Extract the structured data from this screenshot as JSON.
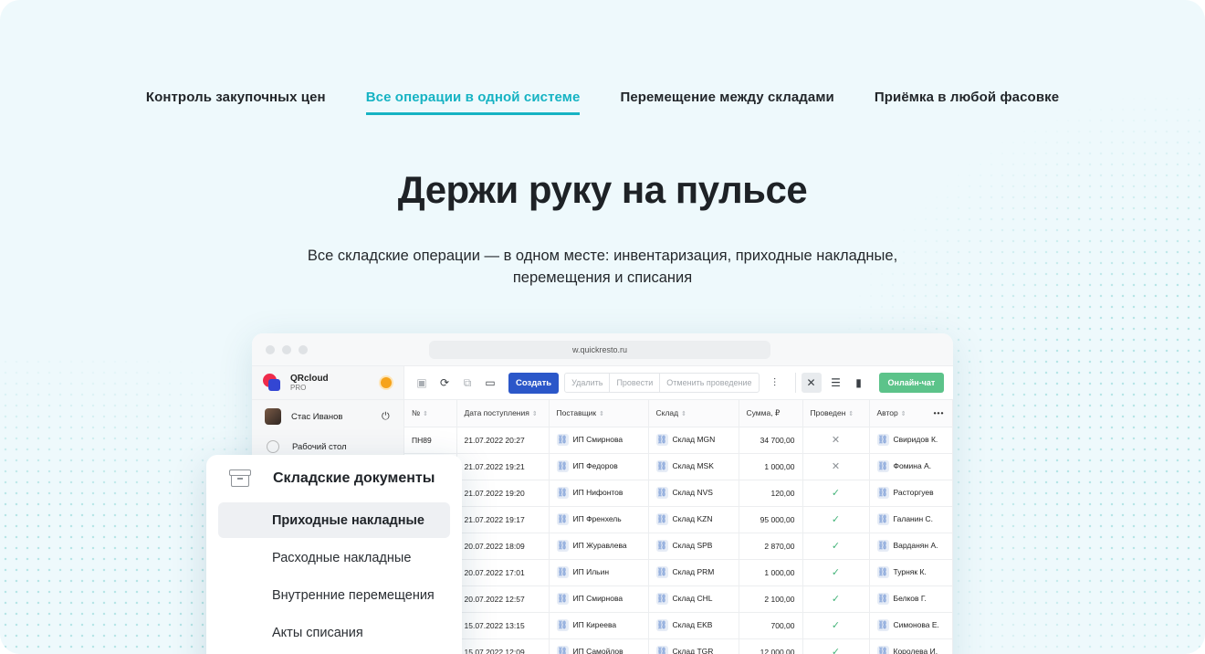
{
  "tabs": [
    {
      "label": "Контроль закупочных цен",
      "active": false
    },
    {
      "label": "Все операции в одной системе",
      "active": true
    },
    {
      "label": "Перемещение между складами",
      "active": false
    },
    {
      "label": "Приёмка в любой фасовке",
      "active": false
    }
  ],
  "headline": "Держи руку на пульсе",
  "subtitle_line1": "Все складские операции — в одном месте: инвентаризация, приходные накладные,",
  "subtitle_line2": "перемещения и списания",
  "browser": {
    "url": "w.quickresto.ru",
    "brand": {
      "name": "QRcloud",
      "plan": "PRO"
    },
    "user": "Стас Иванов",
    "side_items": [
      "Рабочий стол"
    ],
    "toolbar": {
      "create": "Создать",
      "delete": "Удалить",
      "post": "Провести",
      "unpost": "Отменить проведение",
      "chat": "Онлайн-чат"
    },
    "columns": [
      "№",
      "Дата поступления",
      "Поставщик",
      "Склад",
      "Сумма, ₽",
      "Проведен",
      "Автор"
    ],
    "rows": [
      {
        "num": "ПН89",
        "date": "21.07.2022 20:27",
        "supplier": "ИП Смирнова",
        "warehouse": "Склад MGN",
        "sum": "34 700,00",
        "posted": false,
        "author": "Свиридов К."
      },
      {
        "num": "",
        "date": "21.07.2022 19:21",
        "supplier": "ИП Федоров",
        "warehouse": "Склад MSK",
        "sum": "1 000,00",
        "posted": false,
        "author": "Фомина А."
      },
      {
        "num": "",
        "date": "21.07.2022 19:20",
        "supplier": "ИП Нифонтов",
        "warehouse": "Склад NVS",
        "sum": "120,00",
        "posted": true,
        "author": "Расторгуев"
      },
      {
        "num": "",
        "date": "21.07.2022 19:17",
        "supplier": "ИП Френхель",
        "warehouse": "Склад KZN",
        "sum": "95 000,00",
        "posted": true,
        "author": "Галанин С."
      },
      {
        "num": "",
        "date": "20.07.2022 18:09",
        "supplier": "ИП Журавлева",
        "warehouse": "Склад SPB",
        "sum": "2 870,00",
        "posted": true,
        "author": "Варданян А."
      },
      {
        "num": "",
        "date": "20.07.2022 17:01",
        "supplier": "ИП Ильин",
        "warehouse": "Склад PRM",
        "sum": "1 000,00",
        "posted": true,
        "author": "Турняк К."
      },
      {
        "num": "",
        "date": "20.07.2022 12:57",
        "supplier": "ИП Смирнова",
        "warehouse": "Склад CHL",
        "sum": "2 100,00",
        "posted": true,
        "author": "Белков Г."
      },
      {
        "num": "",
        "date": "15.07.2022 13:15",
        "supplier": "ИП Киреева",
        "warehouse": "Склад EKB",
        "sum": "700,00",
        "posted": true,
        "author": "Симонова Е."
      },
      {
        "num": "",
        "date": "15.07.2022 12:09",
        "supplier": "ИП Самойлов",
        "warehouse": "Склад TGR",
        "sum": "12 000,00",
        "posted": true,
        "author": "Королева И."
      }
    ]
  },
  "doc_menu": {
    "title": "Складские документы",
    "items": [
      {
        "label": "Приходные накладные",
        "active": true
      },
      {
        "label": "Расходные накладные",
        "active": false
      },
      {
        "label": "Внутренние перемещения",
        "active": false
      },
      {
        "label": "Акты списания",
        "active": false
      }
    ]
  },
  "icons": {
    "link": "link-icon",
    "check": "check-icon",
    "cross": "cross-icon",
    "archive": "archive-icon"
  },
  "colors": {
    "accent": "#16b3c3",
    "create": "#2b57c9",
    "chat": "#5cc38a",
    "check": "#45b47a"
  }
}
